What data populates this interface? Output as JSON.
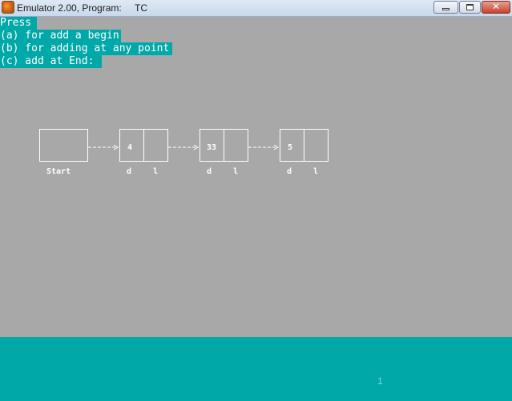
{
  "window": {
    "title": "Emulator 2.00, Program:",
    "program": "TC",
    "close_label": "✕"
  },
  "console": {
    "press": "Press",
    "option_a": "(a) for add a begin",
    "option_b": "(b) for adding at any point",
    "option_c": "(c) add at End:"
  },
  "diagram": {
    "start_label": "Start",
    "nodes": [
      {
        "data": "4",
        "data_label": "d",
        "link_label": "l"
      },
      {
        "data": "33",
        "data_label": "d",
        "link_label": "l"
      },
      {
        "data": "5",
        "data_label": "d",
        "link_label": "l"
      }
    ]
  },
  "status": {
    "page": "1"
  },
  "colors": {
    "console_bg": "#a8a8a8",
    "highlight": "#00a8a8",
    "text": "#ffffff"
  }
}
